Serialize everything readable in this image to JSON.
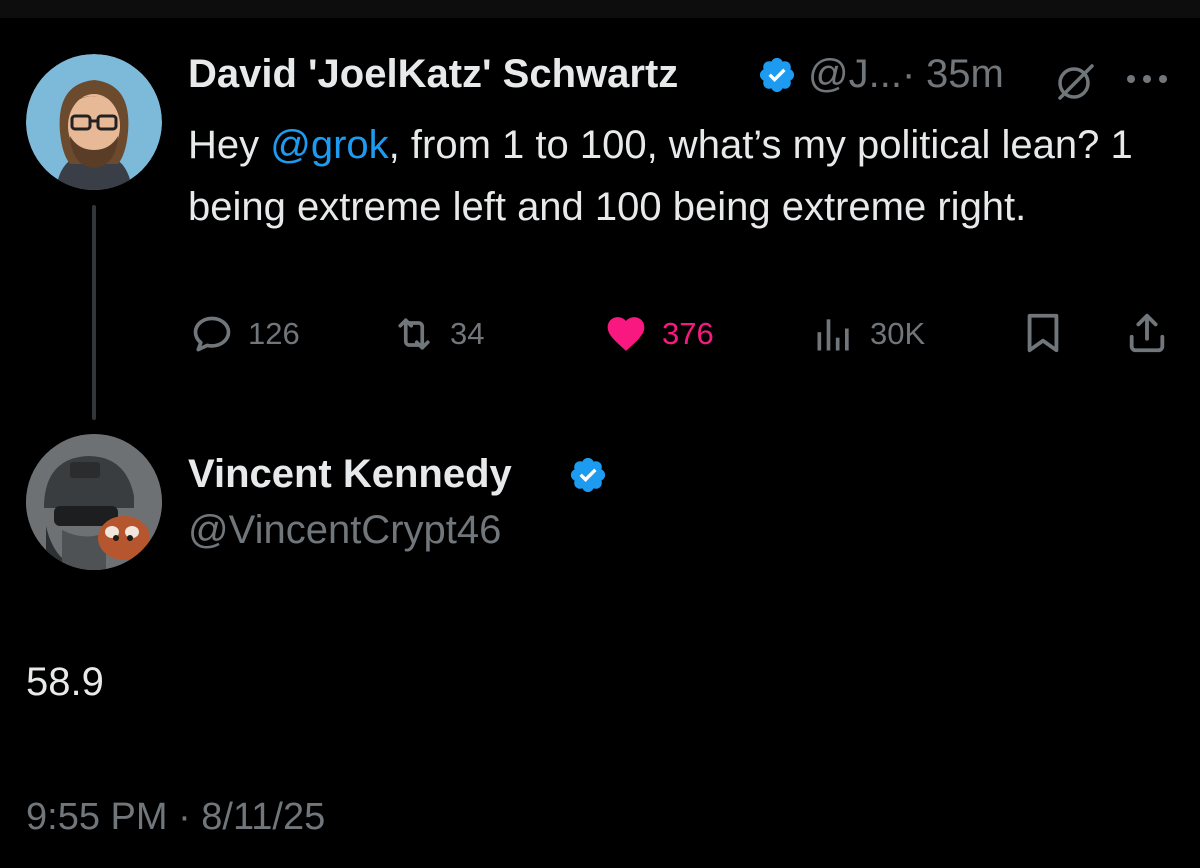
{
  "original_tweet": {
    "author_name": "David 'JoelKatz' Schwartz",
    "handle": "@J...",
    "separator": "·",
    "time_ago": "35m",
    "text_before": "Hey ",
    "mention": "@grok",
    "text_after": ", from 1 to 100, what’s my political lean? 1 being extreme left and 100 being extreme right.",
    "actions": {
      "replies": "126",
      "reposts": "34",
      "likes": "376",
      "views": "30K"
    },
    "icons": [
      "verified-badge-icon",
      "grok-icon",
      "more-icon",
      "reply-icon",
      "repost-icon",
      "heart-icon",
      "views-icon",
      "bookmark-icon",
      "share-icon"
    ]
  },
  "reply_tweet": {
    "author_name": "Vincent Kennedy",
    "handle": "@VincentCrypt46",
    "text": "58.9",
    "timestamp": "9:55 PM · 8/11/25"
  },
  "colors": {
    "background": "#000000",
    "text_primary": "#e7e9ea",
    "text_secondary": "#71767b",
    "link": "#1d9bf0",
    "like": "#f91880",
    "verified": "#1d9bf0"
  }
}
